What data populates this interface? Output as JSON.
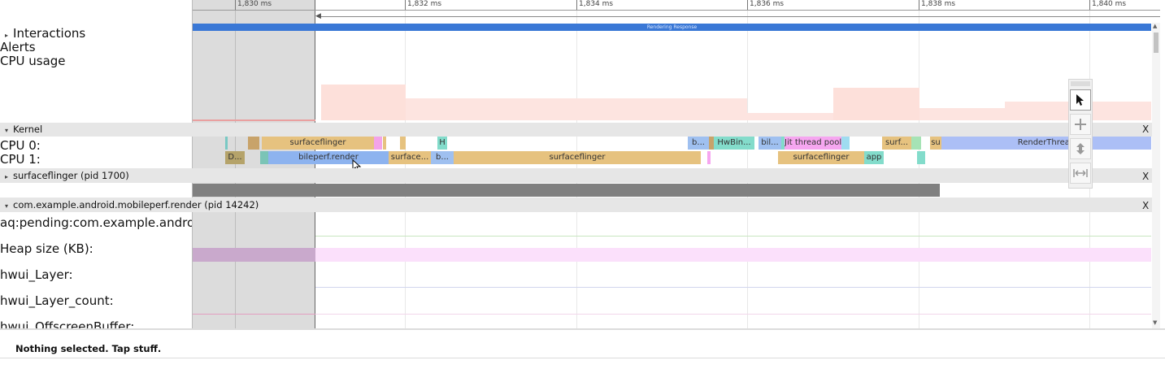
{
  "ruler": {
    "ticks": [
      "1,830 ms",
      "1,832 ms",
      "1,834 ms",
      "1,836 ms",
      "1,838 ms",
      "1,840 ms"
    ]
  },
  "interactions": {
    "label": "Interactions",
    "bar_label": "Rendering Response"
  },
  "tracks_top": {
    "alerts": "Alerts",
    "cpu_usage": "CPU usage"
  },
  "kernel": {
    "label": "Kernel",
    "cpu0": "CPU 0:",
    "cpu1": "CPU 1:",
    "cpu0_slices": [
      "surfaceflinger",
      "H",
      "b...",
      "HwBin...",
      "bil...",
      "Jit thread pool",
      "surf...",
      "su",
      "RenderThread"
    ],
    "cpu1_slices": [
      "D...",
      "bileperf.render",
      "surface...",
      "b...",
      "surfaceflinger",
      "surfaceflinger",
      "app"
    ]
  },
  "process_sf": {
    "label": "surfaceflinger (pid 1700)"
  },
  "process_app": {
    "label": "com.example.android.mobileperf.render (pid 14242)"
  },
  "counters": [
    "aq:pending:com.example.androi",
    "Heap size (KB):",
    "hwui_Layer:",
    "hwui_Layer_count:",
    "hwui_OffscreenBuffer:"
  ],
  "close_glyph": "X",
  "status": {
    "text": "Nothing selected. Tap stuff."
  },
  "colors": {
    "accent_blue": "#3a78d6",
    "selection_shade": "#cfcfcf",
    "cpu_usage": "#fde4e0",
    "heap_fill": "#fbe0fb"
  }
}
